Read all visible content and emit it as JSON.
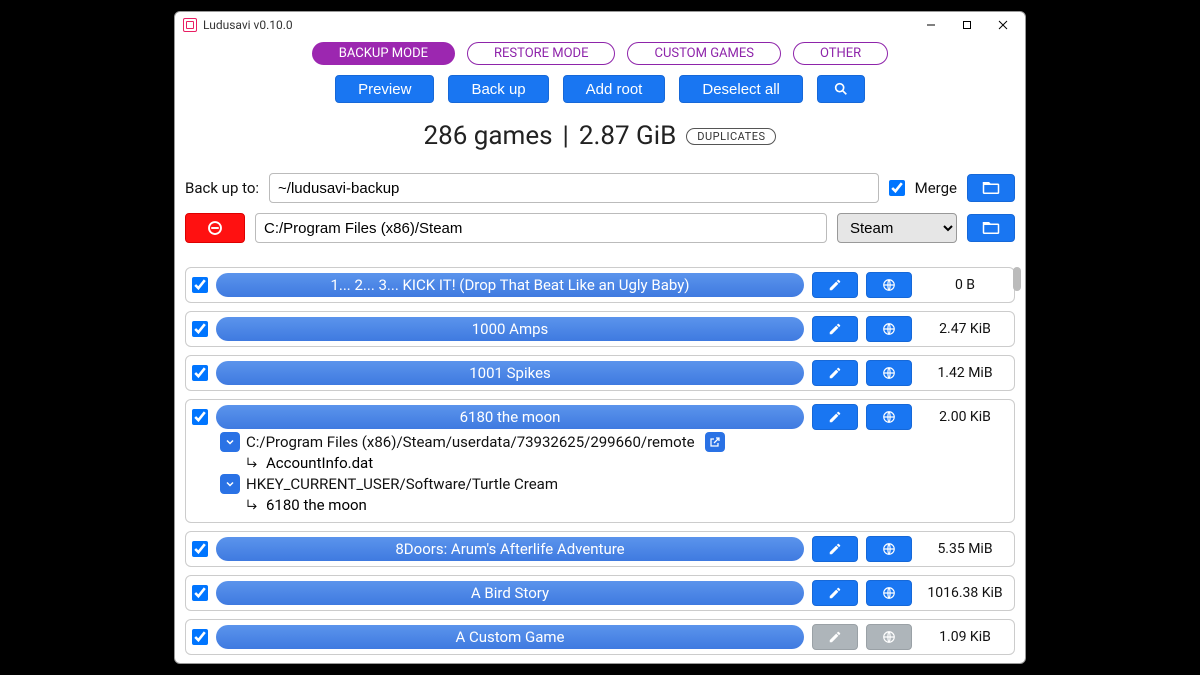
{
  "window": {
    "title": "Ludusavi v0.10.0"
  },
  "modes": {
    "backup": "BACKUP MODE",
    "restore": "RESTORE MODE",
    "custom": "CUSTOM GAMES",
    "other": "OTHER"
  },
  "actions": {
    "preview": "Preview",
    "backup": "Back up",
    "add_root": "Add root",
    "deselect_all": "Deselect all"
  },
  "summary": {
    "games": "286 games",
    "sep": "|",
    "size": "2.87 GiB",
    "duplicates_label": "DUPLICATES"
  },
  "backup_to": {
    "label": "Back up to:",
    "path": "~/ludusavi-backup",
    "merge_label": "Merge",
    "merge_checked": true
  },
  "root": {
    "path": "C:/Program Files (x86)/Steam",
    "store": "Steam"
  },
  "games": [
    {
      "title": "1... 2... 3... KICK IT! (Drop That Beat Like an Ugly Baby)",
      "size": "0 B",
      "checked": true,
      "web": true
    },
    {
      "title": "1000 Amps",
      "size": "2.47 KiB",
      "checked": true,
      "web": true
    },
    {
      "title": "1001 Spikes",
      "size": "1.42 MiB",
      "checked": true,
      "web": true
    },
    {
      "title": "6180 the moon",
      "size": "2.00 KiB",
      "checked": true,
      "web": true,
      "expanded": true,
      "details": [
        {
          "path": "C:/Program Files (x86)/Steam/userdata/73932625/299660/remote",
          "openable": true,
          "child": "AccountInfo.dat"
        },
        {
          "path": "HKEY_CURRENT_USER/Software/Turtle Cream",
          "openable": false,
          "child": "6180 the moon"
        }
      ]
    },
    {
      "title": "8Doors: Arum's Afterlife Adventure",
      "size": "5.35 MiB",
      "checked": true,
      "web": true
    },
    {
      "title": "A Bird Story",
      "size": "1016.38 KiB",
      "checked": true,
      "web": true
    },
    {
      "title": "A Custom Game",
      "size": "1.09 KiB",
      "checked": true,
      "web": false,
      "edit_disabled": true
    }
  ]
}
